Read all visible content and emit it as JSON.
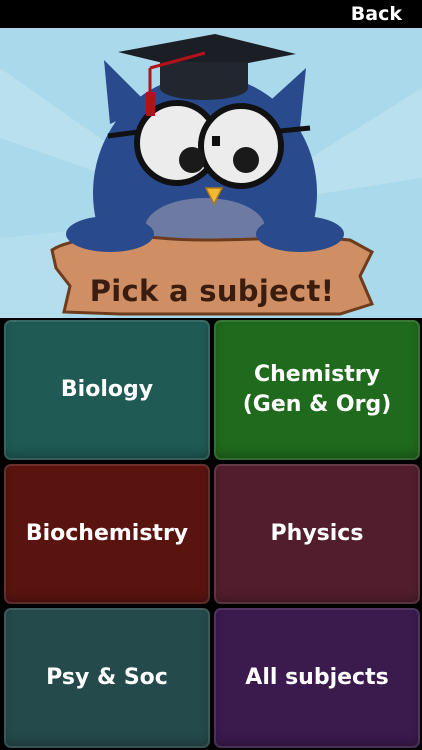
{
  "header": {
    "back_label": "Back"
  },
  "hero": {
    "banner_text": "Pick a subject!"
  },
  "subjects": [
    {
      "label": "Biology",
      "color": "#1f5a55"
    },
    {
      "label": "Chemistry\n(Gen & Org)",
      "color": "#1f6a1c"
    },
    {
      "label": "Biochemistry",
      "color": "#5a1410"
    },
    {
      "label": "Physics",
      "color": "#521e2e"
    },
    {
      "label": "Psy & Soc",
      "color": "#254a4c"
    },
    {
      "label": "All subjects",
      "color": "#3b1a4e"
    }
  ],
  "colors": {
    "sky": "#a9d9ea",
    "owl_body": "#2a4a8e",
    "banner": "#cf8e63",
    "tassel": "#b3121a"
  },
  "icons": [
    "owl-mascot-icon",
    "graduation-cap-icon"
  ]
}
